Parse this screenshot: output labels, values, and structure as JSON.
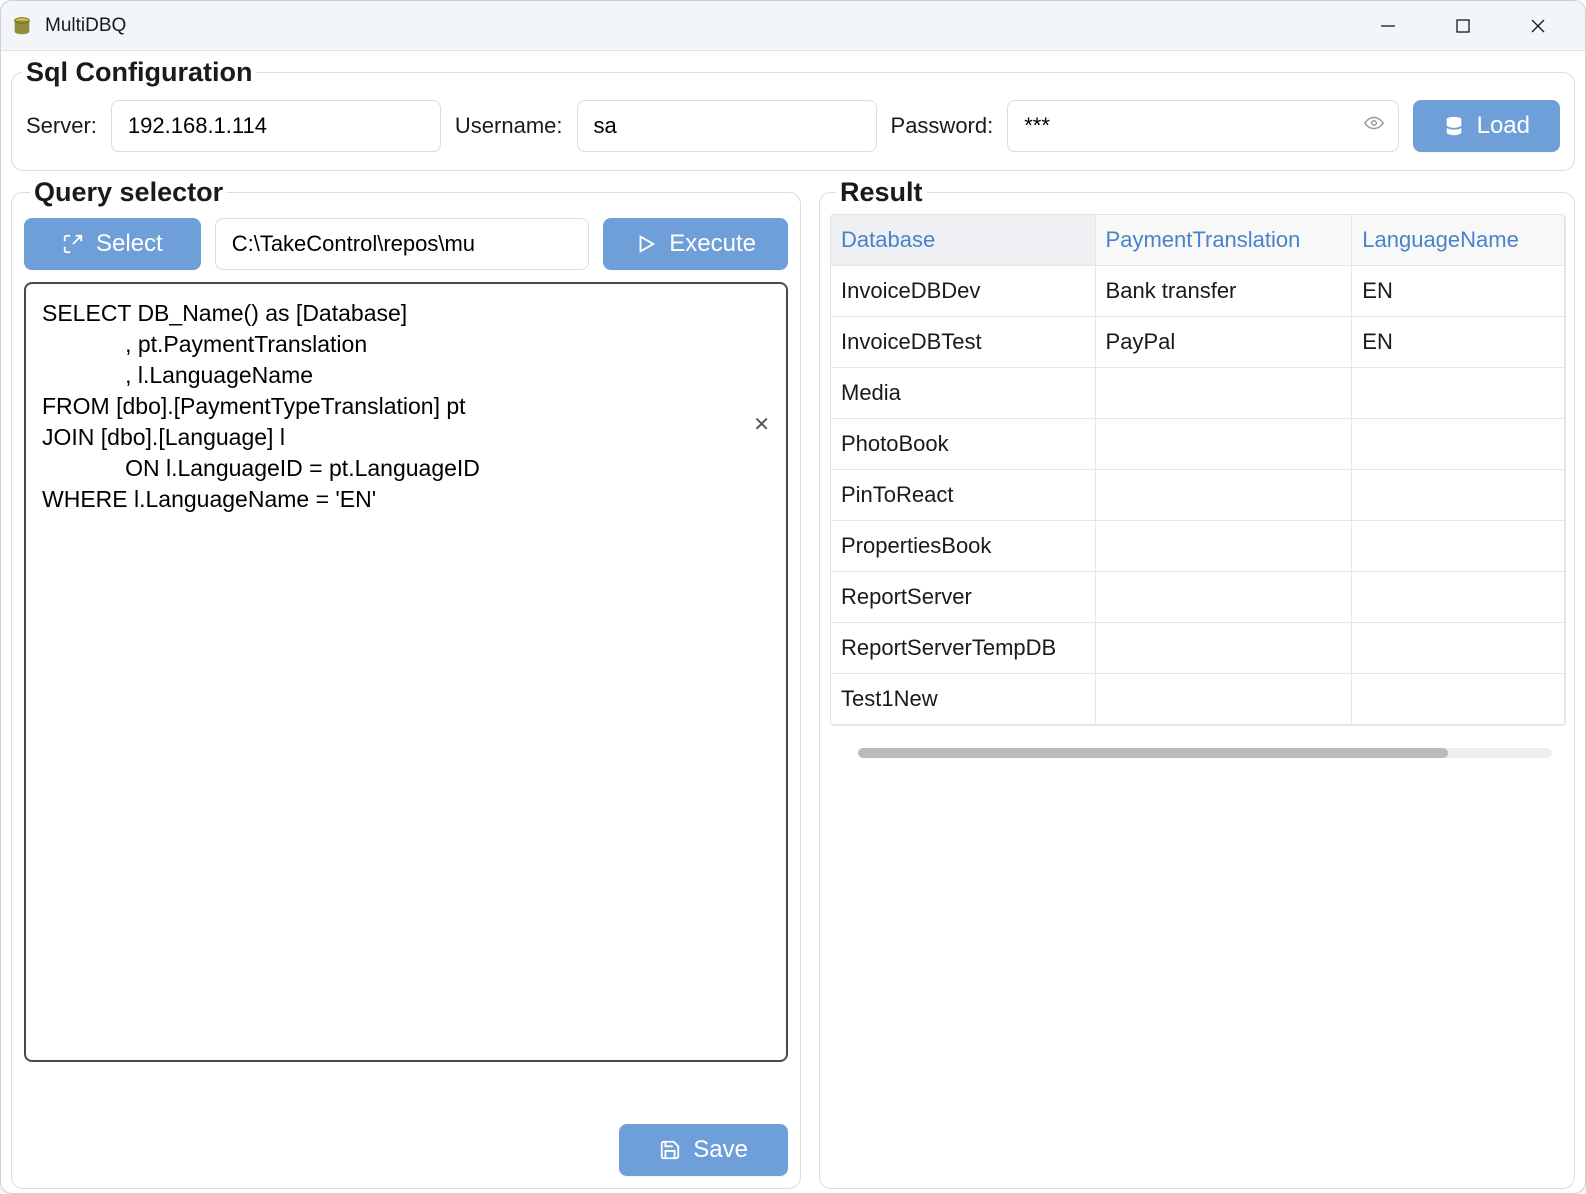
{
  "window": {
    "title": "MultiDBQ"
  },
  "config": {
    "group_title": "Sql Configuration",
    "server_label": "Server:",
    "server_value": "192.168.1.114",
    "username_label": "Username:",
    "username_value": "sa",
    "password_label": "Password:",
    "password_value": "***",
    "load_label": "Load"
  },
  "query": {
    "group_title": "Query selector",
    "select_label": "Select",
    "execute_label": "Execute",
    "save_label": "Save",
    "path_value": "C:\\TakeControl\\repos\\mu",
    "sql_value": "SELECT DB_Name() as [Database]\n             , pt.PaymentTranslation\n             , l.LanguageName\nFROM [dbo].[PaymentTypeTranslation] pt\nJOIN [dbo].[Language] l\n             ON l.LanguageID = pt.LanguageID\nWHERE l.LanguageName = 'EN'"
  },
  "result": {
    "group_title": "Result",
    "columns": [
      "Database",
      "PaymentTranslation",
      "LanguageName"
    ],
    "rows": [
      {
        "Database": "InvoiceDBDev",
        "PaymentTranslation": "Bank transfer",
        "LanguageName": "EN"
      },
      {
        "Database": "InvoiceDBTest",
        "PaymentTranslation": "PayPal",
        "LanguageName": "EN"
      },
      {
        "Database": "Media",
        "PaymentTranslation": "",
        "LanguageName": ""
      },
      {
        "Database": "PhotoBook",
        "PaymentTranslation": "",
        "LanguageName": ""
      },
      {
        "Database": "PinToReact",
        "PaymentTranslation": "",
        "LanguageName": ""
      },
      {
        "Database": "PropertiesBook",
        "PaymentTranslation": "",
        "LanguageName": ""
      },
      {
        "Database": "ReportServer",
        "PaymentTranslation": "",
        "LanguageName": ""
      },
      {
        "Database": "ReportServerTempDB",
        "PaymentTranslation": "",
        "LanguageName": ""
      },
      {
        "Database": "Test1New",
        "PaymentTranslation": "",
        "LanguageName": ""
      }
    ]
  }
}
